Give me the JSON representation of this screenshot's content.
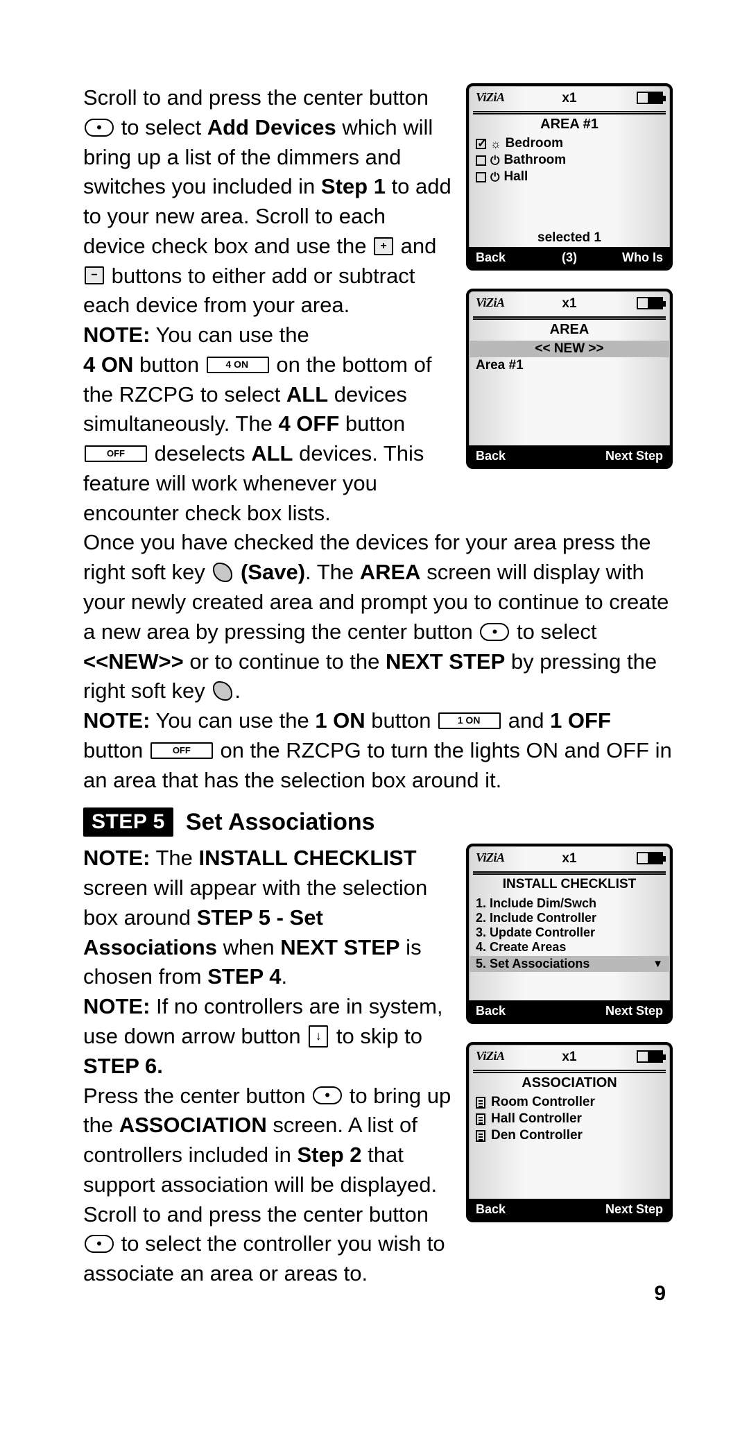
{
  "page_number": "9",
  "paragraphs": {
    "p1_a": "Scroll to and press the center button",
    "p1_b": "to select ",
    "p1_bold_addDevices": "Add Devices",
    "p1_c": " which will bring up a list of the dimmers and switches you included in ",
    "p1_bold_step1": "Step 1",
    "p1_d": " to add to your new area. Scroll to each device check box and use the ",
    "p1_e": "and",
    "p1_f": " buttons to either add or subtract each device from your area.",
    "note1_a": "NOTE:",
    "note1_b": " You can use the ",
    "note1_bold_4on": "4 ON",
    "note1_c": " button ",
    "note1_d": " on the bottom of the RZCPG to select ",
    "note1_bold_all1": "ALL",
    "note1_e": " devices simultaneously. The ",
    "note1_bold_4off": "4 OFF",
    "note1_f": " button ",
    "note1_g": " deselects ",
    "note1_bold_all2": "ALL",
    "note1_h": " devices. This feature will work whenever you encounter check box lists.",
    "p2_a": "Once you have checked the devices for your area press the right soft key ",
    "p2_save": "(Save)",
    "p2_b": ". The ",
    "p2_bold_area": "AREA",
    "p2_c": " screen will display with your newly created area and prompt you to continue to create a new area by pressing the center button ",
    "p2_d": " to select ",
    "p2_bold_new": "<<NEW>>",
    "p2_e": " or to continue to the ",
    "p2_bold_nextstep": "NEXT STEP",
    "p2_f": " by pressing the right soft key",
    "p2_g": ".",
    "note2_a": "NOTE:",
    "note2_b": " You can use the ",
    "note2_bold_1on": "1 ON",
    "note2_c": " button ",
    "note2_d": " and ",
    "note2_bold_1off": "1 OFF",
    "note2_e": " button ",
    "note2_f": " on the RZCPG to turn the lights ON and OFF in an area that has the selection box around it.",
    "step5_badge": "STEP 5",
    "step5_title": "Set Associations",
    "note3_a": "NOTE:",
    "note3_b": " The ",
    "note3_bold_install": "INSTALL CHECKLIST",
    "note3_c": " screen will appear with the selection box around ",
    "note3_bold_step5label": "STEP 5 - Set Associations",
    "note3_d": " when ",
    "note3_bold_nextstep2": "NEXT STEP",
    "note3_e": " is chosen from ",
    "note3_bold_step4": "STEP 4",
    "note3_f": ".",
    "note4_a": "NOTE:",
    "note4_b": " If no controllers are in system, use down arrow button ",
    "note4_c": " to skip to ",
    "note4_bold_step6": "STEP 6.",
    "p3_a": "Press the center button ",
    "p3_b": " to bring up the ",
    "p3_bold_assoc": "ASSOCIATION",
    "p3_c": " screen. A list of controllers included in ",
    "p3_bold_step2": "Step 2",
    "p3_d": " that support association will be displayed.",
    "p4_a": "Scroll to and press the center button ",
    "p4_b": " to select the controller you wish to associate an area or areas to."
  },
  "keys": {
    "center_dot": "•",
    "plus": "+",
    "minus": "−",
    "four_on": "4 ON",
    "off": "OFF",
    "one_on": "1 ON",
    "arrow_down": "↓"
  },
  "screens": {
    "area1": {
      "logo": "ViZiA",
      "x1": "x1",
      "title": "AREA #1",
      "rows": [
        {
          "checked": true,
          "icon": "☼",
          "label": "Bedroom"
        },
        {
          "checked": false,
          "icon": "⏻",
          "label": "Bathroom"
        },
        {
          "checked": false,
          "icon": "⏻",
          "label": "Hall"
        }
      ],
      "hint": "selected 1",
      "footer_left": "Back",
      "footer_mid": "(3)",
      "footer_right": "Who Is"
    },
    "arealist": {
      "title": "AREA",
      "new_row": "<< NEW >>",
      "items": [
        "Area #1"
      ],
      "footer_left": "Back",
      "footer_right": "Next Step"
    },
    "checklist": {
      "title": "INSTALL CHECKLIST",
      "items": [
        "1.  Include Dim/Swch",
        "2.  Include Controller",
        "3.  Update Controller",
        "4.  Create Areas"
      ],
      "highlight": "5.  Set Associations",
      "footer_left": "Back",
      "footer_right": "Next Step"
    },
    "association": {
      "title": "ASSOCIATION",
      "items": [
        "Room Controller",
        "Hall Controller",
        "Den Controller"
      ],
      "footer_left": "Back",
      "footer_right": "Next Step"
    }
  }
}
